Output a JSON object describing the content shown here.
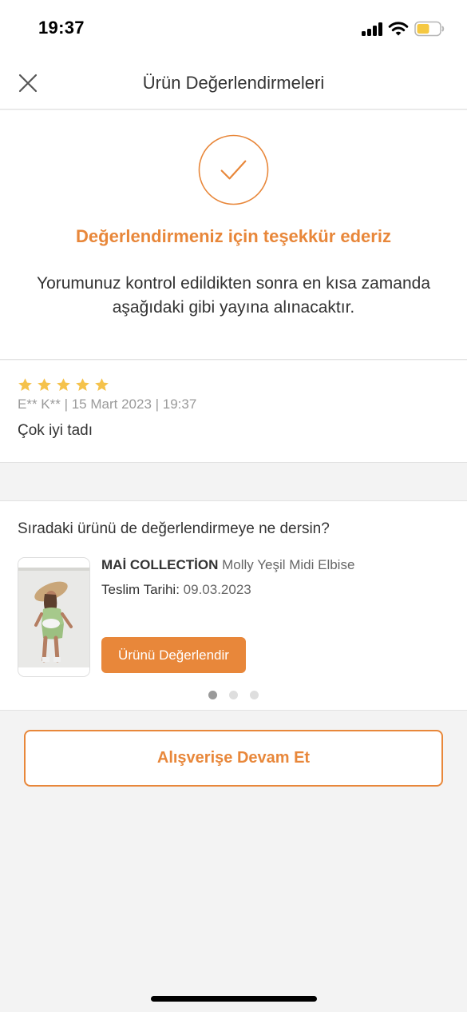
{
  "status_bar": {
    "time": "19:37",
    "icons": [
      "signal-icon",
      "wifi-icon",
      "battery-icon"
    ]
  },
  "header": {
    "title": "Ürün Değerlendirmeleri",
    "close_icon": "close-icon"
  },
  "confirmation": {
    "icon": "check-circle-icon",
    "title": "Değerlendirmeniz için teşekkür ederiz",
    "message": "Yorumunuz kontrol edildikten sonra en kısa zamanda aşağıdaki gibi yayına alınacaktır."
  },
  "review": {
    "rating": 5,
    "max_rating": 5,
    "meta": "E** K** | 15 Mart 2023 | 19:37",
    "text": "Çok iyi tadı"
  },
  "next_product": {
    "question": "Sıradaki ürünü de değerlendirmeye ne dersin?",
    "brand": "MAİ COLLECTİON",
    "name": "Molly Yeşil Midi Elbise",
    "delivery_label": "Teslim Tarihi:",
    "delivery_date": "09.03.2023",
    "button_label": "Ürünü Değerlendir",
    "carousel_count": 3,
    "carousel_active": 0
  },
  "continue_button": {
    "label": "Alışverişe Devam Et"
  },
  "colors": {
    "accent": "#e8873a",
    "star": "#f5c24b",
    "background": "#f3f3f3"
  }
}
